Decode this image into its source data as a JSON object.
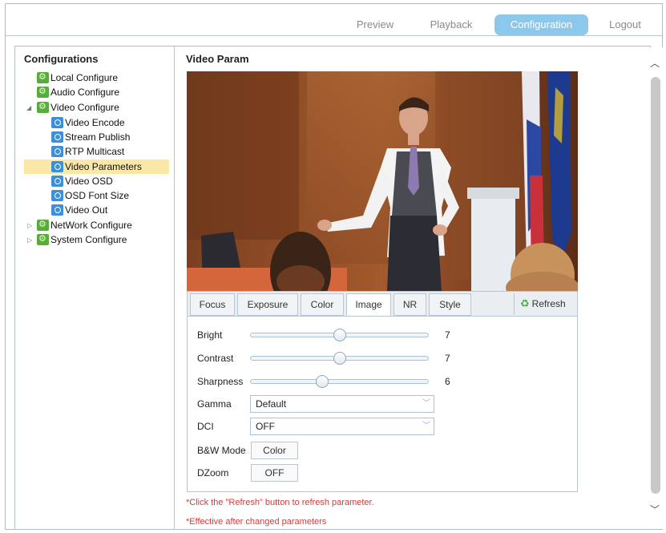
{
  "nav": {
    "preview": "Preview",
    "playback": "Playback",
    "configuration": "Configuration",
    "logout": "Logout",
    "active_color": "#8cc8ec"
  },
  "sidebar": {
    "title": "Configurations",
    "items": [
      {
        "label": "Local Configure",
        "icon": "gear-icon"
      },
      {
        "label": "Audio Configure",
        "icon": "gear-icon"
      },
      {
        "label": "Video Configure",
        "icon": "gear-icon",
        "expanded": true
      },
      {
        "label": "Video Encode",
        "icon": "video-config-icon"
      },
      {
        "label": "Stream Publish",
        "icon": "video-config-icon"
      },
      {
        "label": "RTP Multicast",
        "icon": "video-config-icon"
      },
      {
        "label": "Video Parameters",
        "icon": "video-config-icon",
        "selected": true
      },
      {
        "label": "Video OSD",
        "icon": "video-config-icon"
      },
      {
        "label": "OSD Font Size",
        "icon": "video-config-icon"
      },
      {
        "label": "Video Out",
        "icon": "video-config-icon"
      },
      {
        "label": "NetWork Configure",
        "icon": "gear-icon",
        "expanded": false
      },
      {
        "label": "System Configure",
        "icon": "gear-icon",
        "expanded": false
      }
    ]
  },
  "main": {
    "title": "Video Param",
    "tabs": [
      "Focus",
      "Exposure",
      "Color",
      "Image",
      "NR",
      "Style"
    ],
    "active_tab": "Image",
    "refresh_label": "Refresh",
    "params": {
      "bright": {
        "label": "Bright",
        "value": "7",
        "level": 0.5
      },
      "contrast": {
        "label": "Contrast",
        "value": "7",
        "level": 0.5
      },
      "sharpness": {
        "label": "Sharpness",
        "value": "6",
        "level": 0.4
      },
      "gamma": {
        "label": "Gamma",
        "value": "Default"
      },
      "dci": {
        "label": "DCI",
        "value": "OFF"
      },
      "bw_mode": {
        "label": "B&W Mode",
        "value": "Color"
      },
      "dzoom": {
        "label": "DZoom",
        "value": "OFF"
      }
    },
    "notes": [
      "*Click the \"Refresh\" button to refresh parameter.",
      "*Effective after changed parameters"
    ]
  }
}
